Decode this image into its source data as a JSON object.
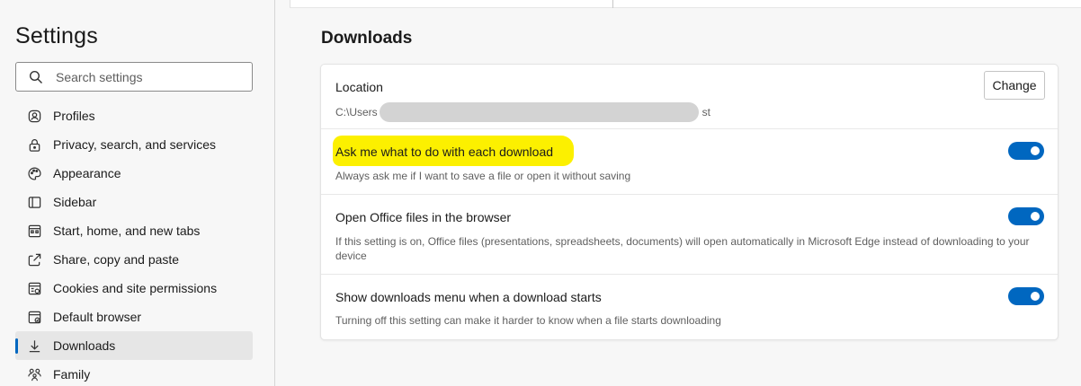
{
  "sidebar": {
    "title": "Settings",
    "search_placeholder": "Search settings",
    "items": [
      {
        "label": "Profiles",
        "icon": "profile-icon"
      },
      {
        "label": "Privacy, search, and services",
        "icon": "lock-icon"
      },
      {
        "label": "Appearance",
        "icon": "palette-icon"
      },
      {
        "label": "Sidebar",
        "icon": "sidebar-icon"
      },
      {
        "label": "Start, home, and new tabs",
        "icon": "home-grid-icon"
      },
      {
        "label": "Share, copy and paste",
        "icon": "share-icon"
      },
      {
        "label": "Cookies and site permissions",
        "icon": "cookie-permissions-icon"
      },
      {
        "label": "Default browser",
        "icon": "browser-icon"
      },
      {
        "label": "Downloads",
        "icon": "download-icon",
        "active": true
      },
      {
        "label": "Family",
        "icon": "family-icon"
      }
    ]
  },
  "main": {
    "title": "Downloads",
    "location": {
      "label": "Location",
      "path_start": "C:\\Users",
      "path_end": "st",
      "button": "Change"
    },
    "settings": [
      {
        "title": "Ask me what to do with each download",
        "description": "Always ask me if I want to save a file or open it without saving",
        "enabled": true,
        "highlighted": true
      },
      {
        "title": "Open Office files in the browser",
        "description": "If this setting is on, Office files (presentations, spreadsheets, documents) will open automatically in Microsoft Edge instead of downloading to your device",
        "enabled": true
      },
      {
        "title": "Show downloads menu when a download starts",
        "description": "Turning off this setting can make it harder to know when a file starts downloading",
        "enabled": true
      }
    ]
  },
  "colors": {
    "accent": "#0067c0",
    "highlight": "#fcf000"
  }
}
